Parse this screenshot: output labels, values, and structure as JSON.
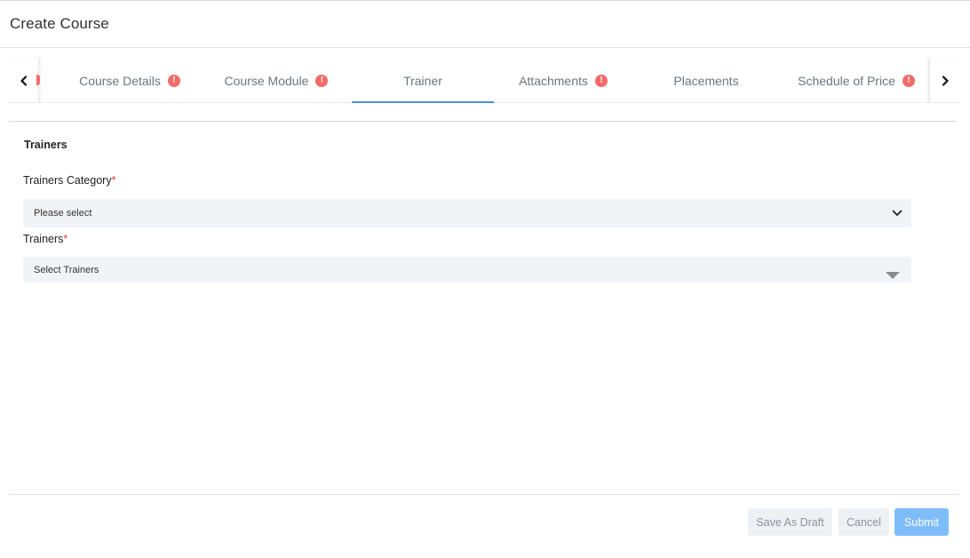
{
  "header": {
    "title": "Create Course"
  },
  "tabs": [
    {
      "label": "Course Details",
      "warning": true,
      "active": false
    },
    {
      "label": "Course Module",
      "warning": true,
      "active": false
    },
    {
      "label": "Trainer",
      "warning": false,
      "active": true
    },
    {
      "label": "Attachments",
      "warning": true,
      "active": false
    },
    {
      "label": "Placements",
      "warning": false,
      "active": false
    },
    {
      "label": "Schedule of Price",
      "warning": true,
      "active": false
    }
  ],
  "section": {
    "title": "Trainers"
  },
  "fields": {
    "trainers_category": {
      "label": "Trainers Category",
      "required_mark": "*",
      "value": "Please select"
    },
    "trainers": {
      "label": "Trainers",
      "required_mark": "*",
      "value": "Select Trainers"
    }
  },
  "footer": {
    "save_draft_label": "Save As Draft",
    "cancel_label": "Cancel",
    "submit_label": "Submit"
  },
  "colors": {
    "accent": "#4a90d9",
    "warning": "#f26b6b",
    "required": "#e53935",
    "submit": "#7fbdfa"
  },
  "icons": {
    "warning_glyph": "!"
  }
}
